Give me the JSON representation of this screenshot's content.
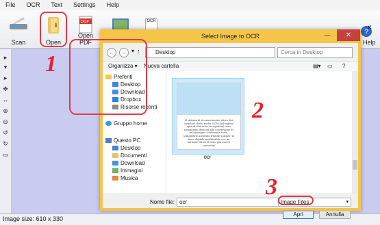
{
  "menu": [
    "File",
    "OCR",
    "Text",
    "Settings",
    "Help"
  ],
  "toolbar": {
    "scan": "Scan",
    "open": "Open",
    "open_pdf": "Open PDF",
    "help": "n Help",
    "hidden_text": "OCR"
  },
  "status": {
    "image_size": "Image size:  610 x  330"
  },
  "dialog": {
    "title": "Select Image to OCR",
    "address": "Desktop",
    "search_placeholder": "Cerca in Desktop",
    "organize": "Organizza ▾",
    "new_folder": "Nuova cartella",
    "nav": {
      "favorites": "Preferiti",
      "fav_items": [
        "Desktop",
        "Download",
        "Dropbox",
        "Risorse recenti"
      ],
      "homegroup": "Gruppo home",
      "this_pc": "Questo PC",
      "pc_items": [
        "Desktop",
        "Documenti",
        "Download",
        "Immagini",
        "Musica"
      ]
    },
    "thumbnail": {
      "caption": "ocr",
      "text": "Il sistema di riconoscimento ottico dei caratteri, detto anche OCR (dall'inglese optical character recognition) sono programmi dedicati alla conversione di un'immagine contenente testo, solitamente acquisite tramite scanner, in testo digitale modificabile con un normale editor. Il testo può essere convertito"
    },
    "filename_label": "Nome file:",
    "filename_value": "ocr",
    "filetype": "Image Files",
    "open_button": "Apri",
    "cancel_button": "Annulla"
  },
  "annotations": {
    "step1": "1",
    "step2": "2",
    "step3": "3"
  },
  "colors": {
    "highlight": "#e03a4a",
    "dialog_frame": "#f5c54a",
    "workspace": "#c9cbf0"
  }
}
